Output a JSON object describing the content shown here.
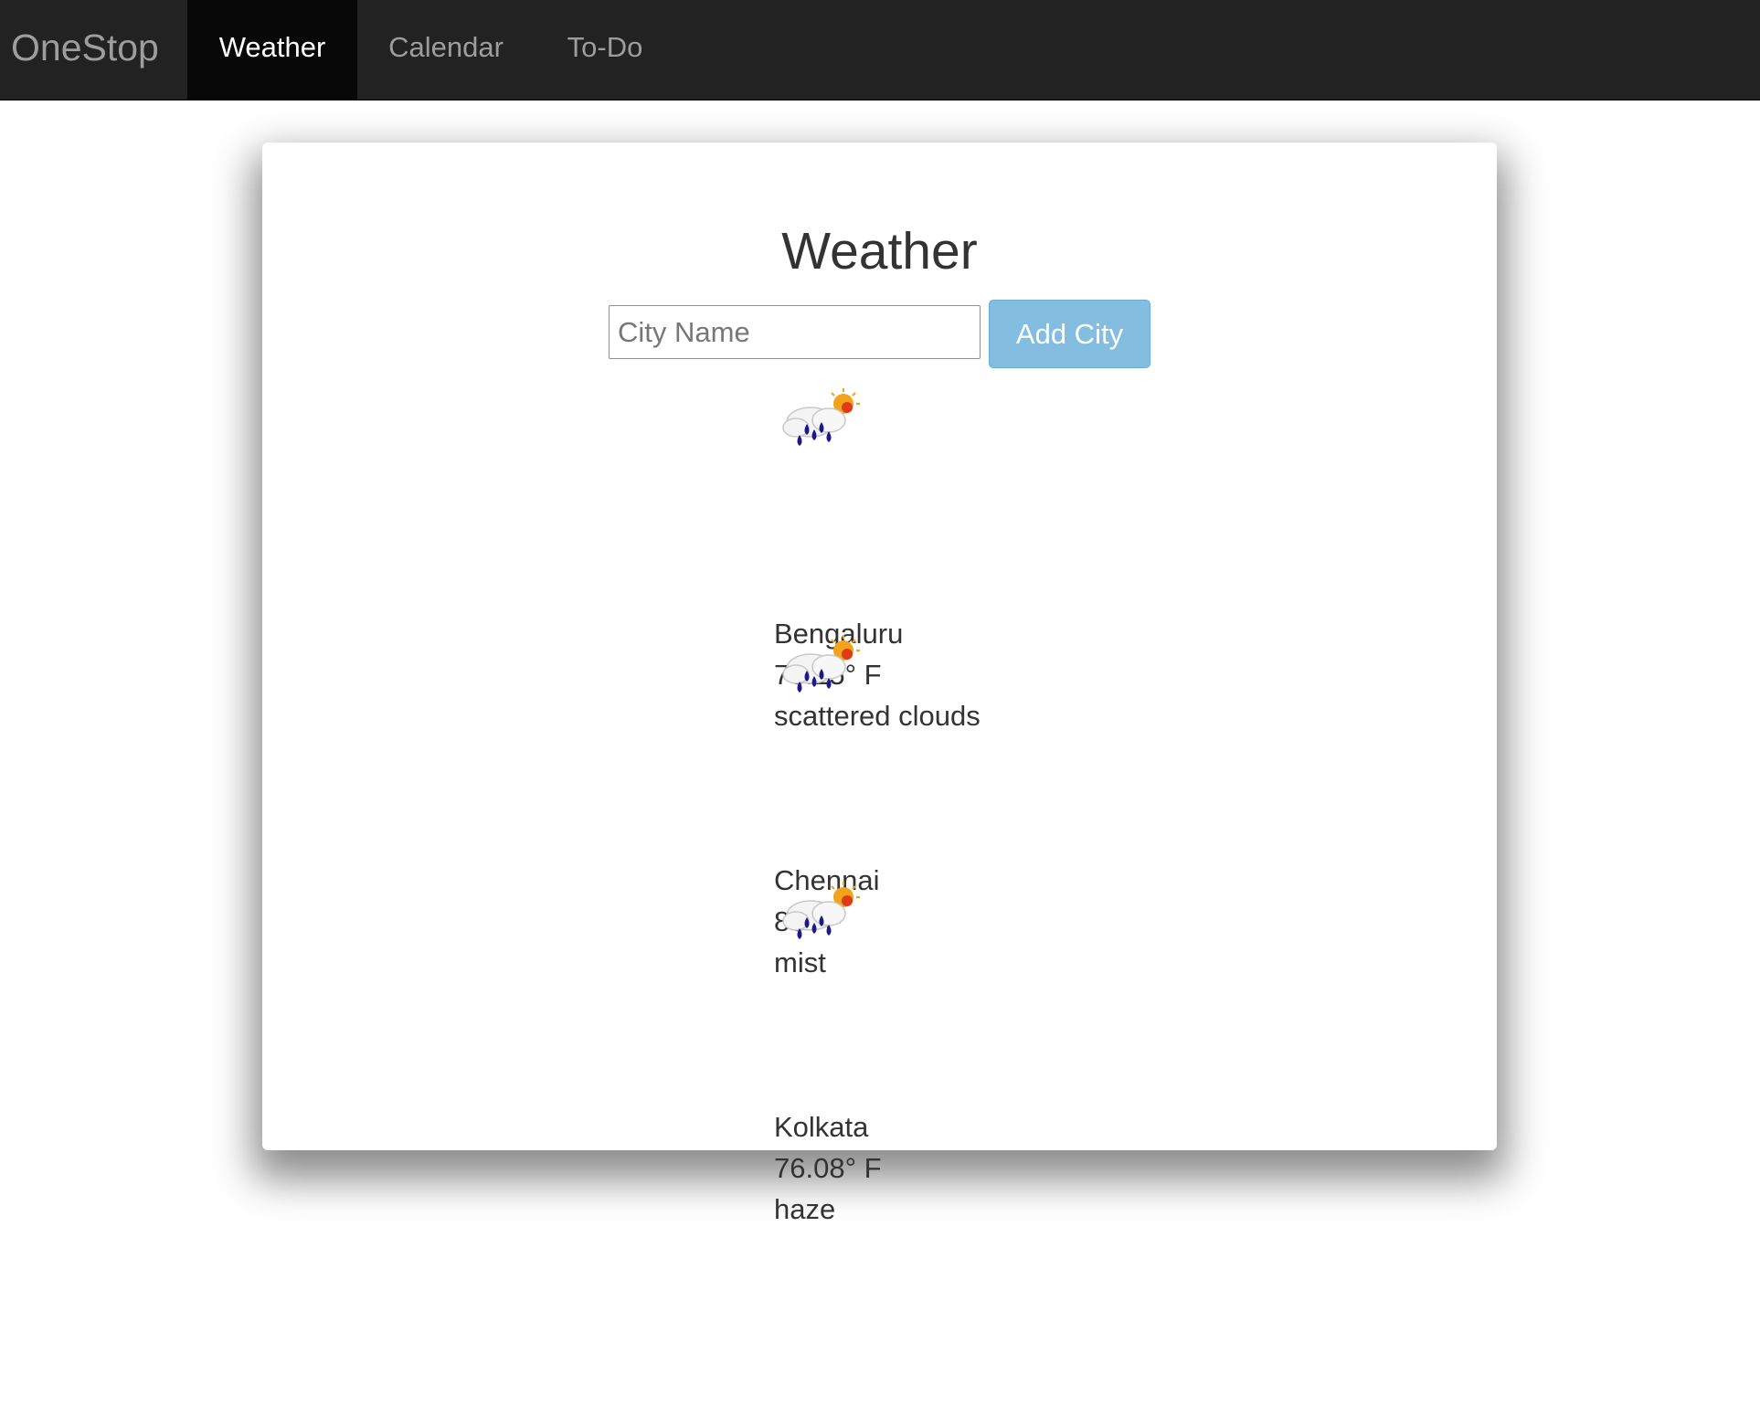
{
  "nav": {
    "brand": "OneStop",
    "items": [
      {
        "label": "Weather",
        "active": true
      },
      {
        "label": "Calendar",
        "active": false
      },
      {
        "label": "To-Do",
        "active": false
      }
    ]
  },
  "main": {
    "title": "Weather",
    "city_input": {
      "placeholder": "City Name",
      "value": ""
    },
    "add_button_label": "Add City",
    "cities": [
      {
        "name": "Bengaluru",
        "temp": "73.15° F",
        "condition": "scattered clouds",
        "icon": "cloud-rain-sun-icon"
      },
      {
        "name": "Chennai",
        "temp": "86° F",
        "condition": "mist",
        "icon": "cloud-rain-sun-icon"
      },
      {
        "name": "Kolkata",
        "temp": "76.08° F",
        "condition": "haze",
        "icon": "cloud-rain-sun-icon"
      }
    ]
  },
  "colors": {
    "navbar_bg": "#222222",
    "navbar_active_bg": "#080808",
    "button_bg": "#83bde0",
    "rain_drop": "#1a1a8c",
    "sun": "#f2a21b"
  }
}
